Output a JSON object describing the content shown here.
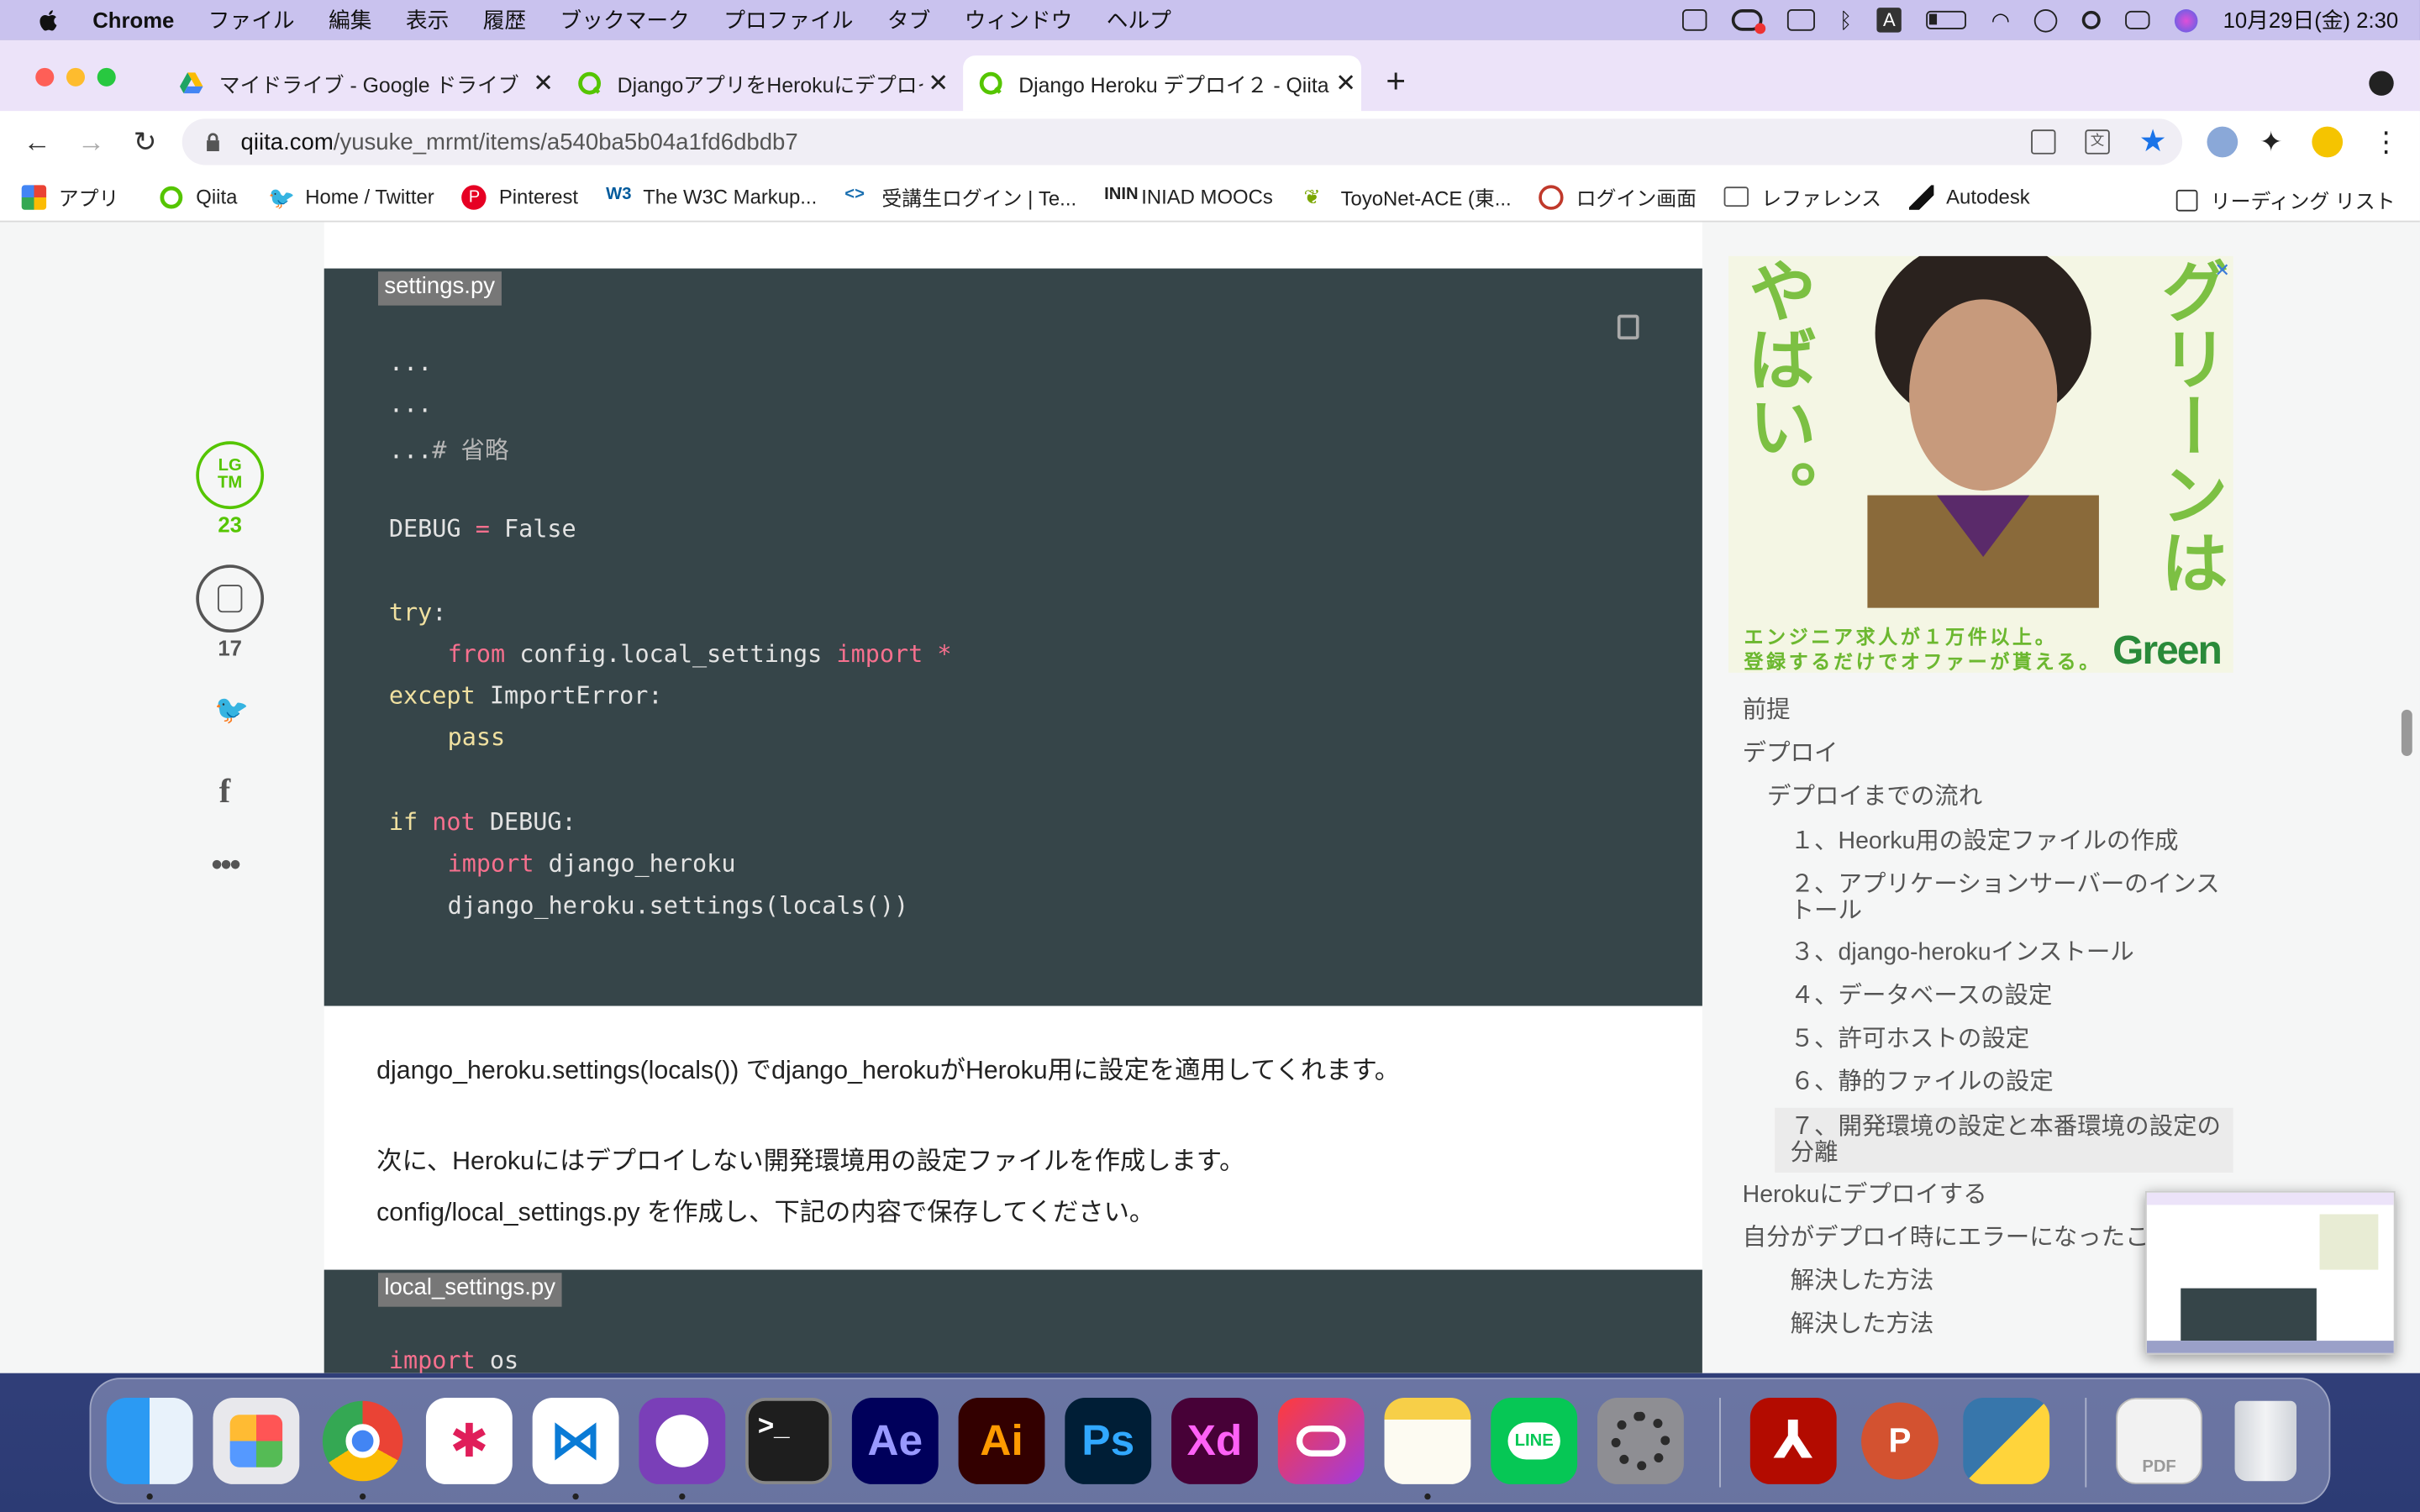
{
  "menubar": {
    "app": "Chrome",
    "items": [
      "ファイル",
      "編集",
      "表示",
      "履歴",
      "ブックマーク",
      "プロファイル",
      "タブ",
      "ウィンドウ",
      "ヘルプ"
    ],
    "clock": "10月29日(金)  2:30"
  },
  "tabs": [
    {
      "title": "マイドライブ - Google ドライブ",
      "icon": "google-drive-icon"
    },
    {
      "title": "DjangoアプリをHerokuにデプロイ",
      "icon": "qiita-icon"
    },
    {
      "title": "Django Heroku デプロイ２ - Qiita",
      "icon": "qiita-icon",
      "active": true
    }
  ],
  "address": {
    "domain": "qiita.com",
    "path": "/yusuke_mrmt/items/a540ba5b04a1fd6dbdb7"
  },
  "bookmarks": [
    "アプリ",
    "Qiita",
    "Home / Twitter",
    "Pinterest",
    "The W3C Markup...",
    "受講生ログイン | Te...",
    "INIAD MOOCs",
    "ToyoNet-ACE (東...",
    "ログイン画面",
    "レファレンス",
    "Autodesk"
  ],
  "reading_list": "リーディング リスト",
  "rail": {
    "lgtm_label": "LG\nTM",
    "lgtm_count": "23",
    "stock_count": "17"
  },
  "code1": {
    "filename": "settings.py",
    "lines": [
      "...",
      "...",
      "...",
      "",
      "DEBUG",
      "",
      "try:",
      "from",
      "except",
      "pass",
      "",
      "if",
      "import",
      "django_heroku.settings(locals())"
    ],
    "comment": "# 省略",
    "debug_eq": " = ",
    "debug_val": "False",
    "try_kw": "try",
    "colon": ":",
    "from_kw": "from",
    "module": " config.local_settings ",
    "import_kw": "import",
    "star": " *",
    "except_kw": "except",
    "exc_name": " ImportError:",
    "pass_kw": "pass",
    "if_kw": "if",
    "not_kw": " not",
    "debug_cond": " DEBUG:",
    "import_kw2": "import",
    "heroku_mod": " django_heroku",
    "settings_call": "django_heroku.settings(locals())"
  },
  "para1": "django_heroku.settings(locals()) でdjango_herokuがHeroku用に設定を適用してくれます。",
  "para2": "次に、Herokuにはデプロイしない開発環境用の設定ファイルを作成します。",
  "para3": "config/local_settings.py を作成し、下記の内容で保存してください。",
  "code2": {
    "filename": "local_settings.py",
    "import_kw": "import",
    "mod": " os"
  },
  "ad": {
    "v1": "やばい。",
    "v2": "グリーンは",
    "band1": "エンジニア求人が１万件以上。",
    "band2": "登録するだけでオファーが貰える。",
    "logo": "Green"
  },
  "toc": [
    {
      "label": "前提",
      "level": 0
    },
    {
      "label": "デプロイ",
      "level": 0
    },
    {
      "label": "デプロイまでの流れ",
      "level": 1
    },
    {
      "label": "１、Heorku用の設定ファイルの作成",
      "level": 2
    },
    {
      "label": "２、アプリケーションサーバーのインス",
      "label2": "トール",
      "level": 2
    },
    {
      "label": "３、django-herokuインストール",
      "level": 2
    },
    {
      "label": "４、データベースの設定",
      "level": 2
    },
    {
      "label": "５、許可ホストの設定",
      "level": 2
    },
    {
      "label": "６、静的ファイルの設定",
      "level": 2
    },
    {
      "label": "７、開発環境の設定と本番環境の設定の",
      "label2": "分離",
      "level": 2,
      "active": true
    },
    {
      "label": "Herokuにデプロイする",
      "level": 0
    },
    {
      "label": "自分がデプロイ時にエラーになったこ",
      "level": 0
    },
    {
      "label": "解決した方法",
      "level": 2
    },
    {
      "label": "解決した方法",
      "level": 2
    }
  ],
  "dock": {
    "ae": "Ae",
    "ai": "Ai",
    "ps": "Ps",
    "xd": "Xd",
    "line": "LINE",
    "pdf": "PDF"
  },
  "colors": {
    "qiita_green": "#55c500",
    "code_bg": "#364549",
    "tabbar": "#ece3f9"
  }
}
